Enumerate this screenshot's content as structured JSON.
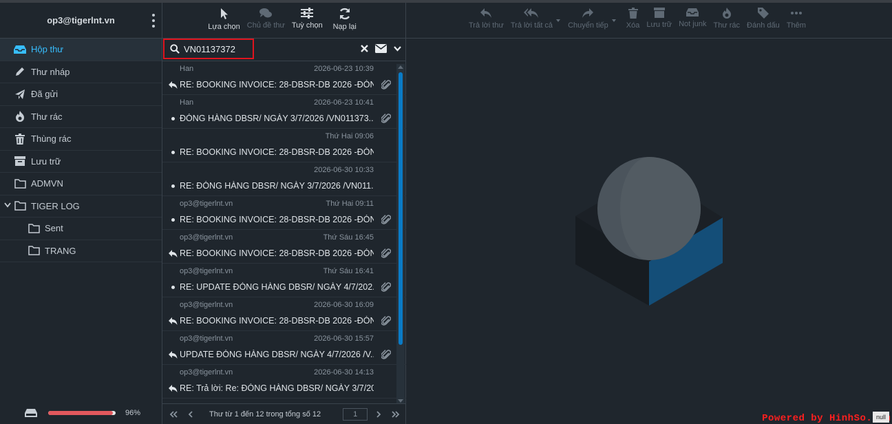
{
  "account": {
    "email": "op3@tigerlnt.vn"
  },
  "folders": [
    {
      "label": "Hộp thư",
      "icon": "inbox-icon",
      "active": true
    },
    {
      "label": "Thư nháp",
      "icon": "pencil-icon"
    },
    {
      "label": "Đã gửi",
      "icon": "paper-plane-icon"
    },
    {
      "label": "Thư rác",
      "icon": "fire-icon"
    },
    {
      "label": "Thùng rác",
      "icon": "trash-icon"
    },
    {
      "label": "Lưu trữ",
      "icon": "archive-icon"
    },
    {
      "label": "ADMVN",
      "icon": "folder-icon"
    },
    {
      "label": "TIGER LOG",
      "icon": "folder-icon",
      "expanded": true
    },
    {
      "label": "Sent",
      "icon": "folder-icon"
    },
    {
      "label": "TRANG",
      "icon": "folder-icon"
    }
  ],
  "quota": {
    "percent_label": "96%",
    "fraction": 0.96
  },
  "mid_toolbar": {
    "select": "Lựa chọn",
    "threads": "Chủ đề thư",
    "options": "Tuỳ chọn",
    "refresh": "Nạp lại"
  },
  "search": {
    "value": "VN01137372"
  },
  "messages": [
    {
      "from": "Han",
      "date": "2026-06-23 10:39",
      "subject": "RE: BOOKING INVOICE: 28-DBSR-DB 2026 -ĐÓNG...",
      "flag": "reply",
      "attachment": true
    },
    {
      "from": "Han",
      "date": "2026-06-23 10:41",
      "subject": "ĐÓNG HÀNG DBSR/ NGÀY 3/7/2026 /VN011373...",
      "flag": "dot",
      "attachment": true
    },
    {
      "from": "",
      "date": "Thứ Hai 09:06",
      "subject": "RE: BOOKING INVOICE: 28-DBSR-DB 2026 -ĐÓNG...",
      "flag": "dot",
      "attachment": false
    },
    {
      "from": "",
      "date": "2026-06-30 10:33",
      "subject": "RE: ĐÓNG HÀNG DBSR/ NGÀY 3/7/2026 /VN011...",
      "flag": "dot",
      "attachment": false
    },
    {
      "from": "op3@tigerlnt.vn",
      "date": "Thứ Hai 09:11",
      "subject": "RE: BOOKING INVOICE: 28-DBSR-DB 2026 -ĐÓNG...",
      "flag": "dot",
      "attachment": true
    },
    {
      "from": "op3@tigerlnt.vn",
      "date": "Thứ Sáu 16:45",
      "subject": "RE: BOOKING INVOICE: 28-DBSR-DB 2026 -ĐÓNG...",
      "flag": "reply",
      "attachment": true
    },
    {
      "from": "op3@tigerlnt.vn",
      "date": "Thứ Sáu 16:41",
      "subject": "RE: UPDATE ĐÓNG HÀNG DBSR/ NGÀY 4/7/202...",
      "flag": "dot",
      "attachment": true
    },
    {
      "from": "op3@tigerlnt.vn",
      "date": "2026-06-30 16:09",
      "subject": "RE: BOOKING INVOICE: 28-DBSR-DB 2026 -ĐÓNG...",
      "flag": "reply",
      "attachment": true
    },
    {
      "from": "op3@tigerlnt.vn",
      "date": "2026-06-30 15:57",
      "subject": "UPDATE ĐÓNG HÀNG DBSR/ NGÀY 4/7/2026 /V...",
      "flag": "reply",
      "attachment": true
    },
    {
      "from": "op3@tigerlnt.vn",
      "date": "2026-06-30 14:13",
      "subject": "RE: Trả lời: Re: ĐÓNG HÀNG DBSR/ NGÀY 3/7/20...",
      "flag": "reply",
      "attachment": false
    }
  ],
  "pager": {
    "text": "Thư từ 1 đến 12 trong tổng số 12",
    "page": "1"
  },
  "right_toolbar": {
    "reply": "Trả lời thư",
    "reply_all": "Trả lời tất cả",
    "forward": "Chuyển tiếp",
    "delete": "Xóa",
    "archive": "Lưu trữ",
    "not_junk": "Not junk",
    "junk": "Thư rác",
    "mark": "Đánh dấu",
    "more": "Thêm"
  },
  "watermark": {
    "text": "Powered by HinhSo.com",
    "badge": "null"
  },
  "colors": {
    "accent": "#37beff",
    "highlight_border": "#e0141e",
    "quota_fill": "#e2585d",
    "scroll_thumb": "#0a7bc6"
  }
}
